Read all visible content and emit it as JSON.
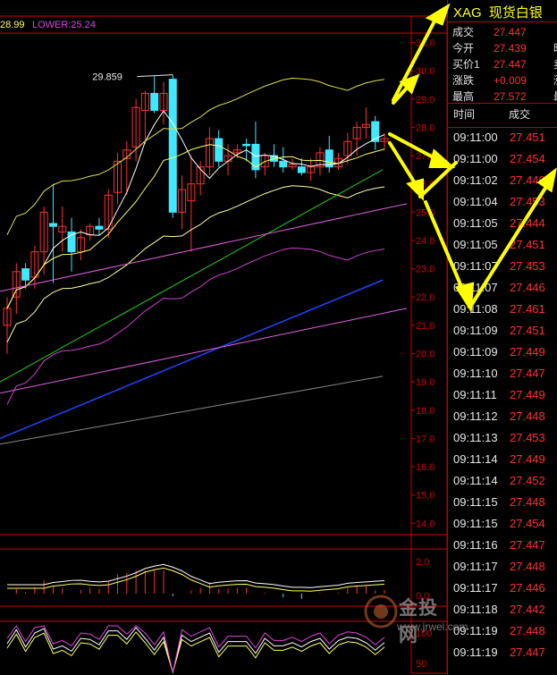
{
  "indicator_header": {
    "mid_value": "28.99",
    "lower_label": "LOWER:25.24",
    "mid_color": "#ffff66",
    "lower_color": "#e040e0"
  },
  "chart_data": {
    "type": "candlestick",
    "price_axis": {
      "ticks": [
        "31.0",
        "30.0",
        "29.0",
        "28.0",
        "27.0",
        "26.0",
        "25.0",
        "24.0",
        "23.0",
        "22.0",
        "21.0",
        "20.0",
        "19.0",
        "18.0",
        "17.0",
        "16.0",
        "15.0",
        "14.0"
      ],
      "ylim": [
        13.6,
        31.3
      ]
    },
    "high_annotation": "29.859",
    "candles": [
      {
        "o": 21.0,
        "h": 22.0,
        "l": 20.0,
        "c": 21.6,
        "up": true
      },
      {
        "o": 22.0,
        "h": 23.2,
        "l": 21.4,
        "c": 22.9,
        "up": true
      },
      {
        "o": 23.0,
        "h": 23.2,
        "l": 22.3,
        "c": 22.6,
        "up": false
      },
      {
        "o": 22.7,
        "h": 23.8,
        "l": 22.3,
        "c": 23.6,
        "up": true
      },
      {
        "o": 23.6,
        "h": 25.2,
        "l": 22.8,
        "c": 25.0,
        "up": true
      },
      {
        "o": 24.6,
        "h": 26.0,
        "l": 22.5,
        "c": 24.5,
        "up": false
      },
      {
        "o": 24.5,
        "h": 25.2,
        "l": 23.6,
        "c": 24.3,
        "up": true
      },
      {
        "o": 24.3,
        "h": 24.8,
        "l": 22.9,
        "c": 23.6,
        "up": false
      },
      {
        "o": 23.6,
        "h": 24.4,
        "l": 23.3,
        "c": 24.1,
        "up": true
      },
      {
        "o": 24.2,
        "h": 24.6,
        "l": 24.0,
        "c": 24.5,
        "up": true
      },
      {
        "o": 24.5,
        "h": 24.8,
        "l": 24.2,
        "c": 24.4,
        "up": false
      },
      {
        "o": 24.4,
        "h": 25.8,
        "l": 24.1,
        "c": 25.6,
        "up": true
      },
      {
        "o": 25.7,
        "h": 27.1,
        "l": 25.3,
        "c": 26.8,
        "up": true
      },
      {
        "o": 26.9,
        "h": 27.5,
        "l": 25.6,
        "c": 27.2,
        "up": true
      },
      {
        "o": 27.3,
        "h": 29.0,
        "l": 26.8,
        "c": 28.7,
        "up": true
      },
      {
        "o": 28.6,
        "h": 29.3,
        "l": 27.4,
        "c": 29.2,
        "up": true
      },
      {
        "o": 29.2,
        "h": 29.8,
        "l": 28.5,
        "c": 28.6,
        "up": false
      },
      {
        "o": 28.6,
        "h": 29.6,
        "l": 28.1,
        "c": 29.2,
        "up": true
      },
      {
        "o": 29.7,
        "h": 29.859,
        "l": 24.8,
        "c": 25.0,
        "up": false
      },
      {
        "o": 25.0,
        "h": 26.3,
        "l": 24.4,
        "c": 25.8,
        "up": true
      },
      {
        "o": 25.4,
        "h": 27.0,
        "l": 23.6,
        "c": 26.0,
        "up": true
      },
      {
        "o": 26.0,
        "h": 26.8,
        "l": 25.6,
        "c": 26.6,
        "up": true
      },
      {
        "o": 26.6,
        "h": 28.0,
        "l": 26.3,
        "c": 27.6,
        "up": true
      },
      {
        "o": 27.6,
        "h": 27.9,
        "l": 26.6,
        "c": 26.8,
        "up": false
      },
      {
        "o": 26.8,
        "h": 27.4,
        "l": 26.3,
        "c": 27.0,
        "up": true
      },
      {
        "o": 27.1,
        "h": 27.4,
        "l": 26.9,
        "c": 27.2,
        "up": true
      },
      {
        "o": 27.4,
        "h": 27.6,
        "l": 26.8,
        "c": 27.4,
        "up": false
      },
      {
        "o": 27.4,
        "h": 28.2,
        "l": 26.2,
        "c": 26.5,
        "up": false
      },
      {
        "o": 26.6,
        "h": 27.1,
        "l": 26.3,
        "c": 27.0,
        "up": true
      },
      {
        "o": 27.0,
        "h": 27.4,
        "l": 26.6,
        "c": 26.8,
        "up": false
      },
      {
        "o": 26.8,
        "h": 27.3,
        "l": 26.4,
        "c": 26.6,
        "up": false
      },
      {
        "o": 26.6,
        "h": 26.9,
        "l": 26.5,
        "c": 26.7,
        "up": true
      },
      {
        "o": 26.6,
        "h": 26.9,
        "l": 26.3,
        "c": 26.4,
        "up": false
      },
      {
        "o": 26.4,
        "h": 26.9,
        "l": 26.1,
        "c": 26.6,
        "up": true
      },
      {
        "o": 26.6,
        "h": 27.3,
        "l": 26.3,
        "c": 27.1,
        "up": true
      },
      {
        "o": 27.2,
        "h": 27.7,
        "l": 26.4,
        "c": 26.6,
        "up": false
      },
      {
        "o": 26.6,
        "h": 27.1,
        "l": 26.5,
        "c": 26.9,
        "up": true
      },
      {
        "o": 27.0,
        "h": 27.8,
        "l": 26.7,
        "c": 27.5,
        "up": true
      },
      {
        "o": 27.6,
        "h": 28.2,
        "l": 27.0,
        "c": 28.0,
        "up": true
      },
      {
        "o": 28.0,
        "h": 28.7,
        "l": 27.6,
        "c": 28.1,
        "up": true
      },
      {
        "o": 28.2,
        "h": 28.4,
        "l": 27.2,
        "c": 27.5,
        "up": false
      },
      {
        "o": 27.5,
        "h": 27.8,
        "l": 27.2,
        "c": 27.6,
        "up": true
      }
    ],
    "macd_axis": [
      "2.0",
      "0.0"
    ],
    "rsi_axis": [
      "100",
      "50"
    ],
    "colors": {
      "up": "#ff3030",
      "down": "#40e8ff",
      "axis": "#cc0000"
    }
  },
  "quote": {
    "symbol": "XAG",
    "name": "现货白银",
    "rows": [
      {
        "label": "成交",
        "value": "27.447",
        "edge": ""
      },
      {
        "label": "今开",
        "value": "27.439",
        "edge": "昨"
      },
      {
        "label": "买价1",
        "value": "27.447",
        "edge": "卖"
      },
      {
        "label": "涨跌",
        "value": "+0.009",
        "edge": "涨"
      },
      {
        "label": "最高",
        "value": "27.572",
        "edge": "最"
      }
    ]
  },
  "ticks": {
    "header_time": "时间",
    "header_price": "成交",
    "rows": [
      {
        "time": "09:11:00",
        "price": "27.451"
      },
      {
        "time": "09:11:00",
        "price": "27.454"
      },
      {
        "time": "09:11:02",
        "price": "27.446"
      },
      {
        "time": "09:11:04",
        "price": "27.453"
      },
      {
        "time": "09:11:05",
        "price": "27.444"
      },
      {
        "time": "09:11:05",
        "price": "27.451"
      },
      {
        "time": "09:11:07",
        "price": "27.453"
      },
      {
        "time": "09:11:07",
        "price": "27.446"
      },
      {
        "time": "09:11:08",
        "price": "27.461"
      },
      {
        "time": "09:11:09",
        "price": "27.451"
      },
      {
        "time": "09:11:09",
        "price": "27.449"
      },
      {
        "time": "09:11:10",
        "price": "27.447"
      },
      {
        "time": "09:11:11",
        "price": "27.449"
      },
      {
        "time": "09:11:12",
        "price": "27.448"
      },
      {
        "time": "09:11:13",
        "price": "27.453"
      },
      {
        "time": "09:11:14",
        "price": "27.449"
      },
      {
        "time": "09:11:14",
        "price": "27.452"
      },
      {
        "time": "09:11:15",
        "price": "27.448"
      },
      {
        "time": "09:11:15",
        "price": "27.454"
      },
      {
        "time": "09:11:16",
        "price": "27.447"
      },
      {
        "time": "09:11:17",
        "price": "27.448"
      },
      {
        "time": "09:11:17",
        "price": "27.446"
      },
      {
        "time": "09:11:18",
        "price": "27.442"
      },
      {
        "time": "09:11:19",
        "price": "27.448"
      },
      {
        "time": "09:11:19",
        "price": "27.447"
      }
    ]
  },
  "watermark": {
    "brand": "金投网",
    "url": "www.jrwei.com"
  }
}
